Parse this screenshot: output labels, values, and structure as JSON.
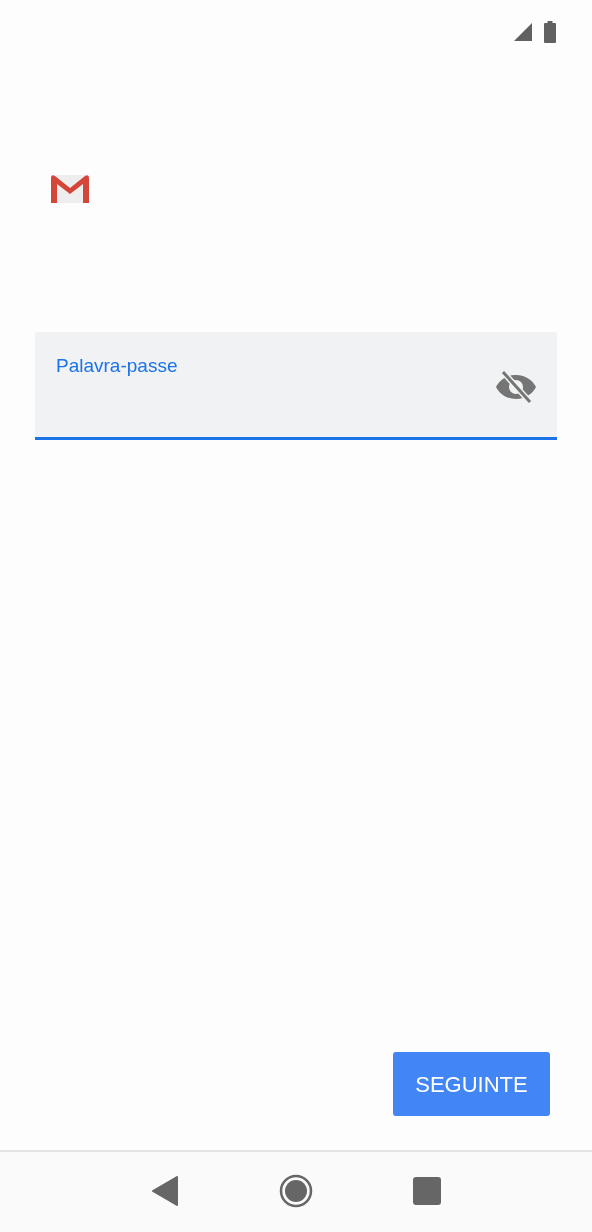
{
  "password_field": {
    "label": "Palavra-passe",
    "focused": true
  },
  "next_button": {
    "label": "SEGUINTE"
  }
}
